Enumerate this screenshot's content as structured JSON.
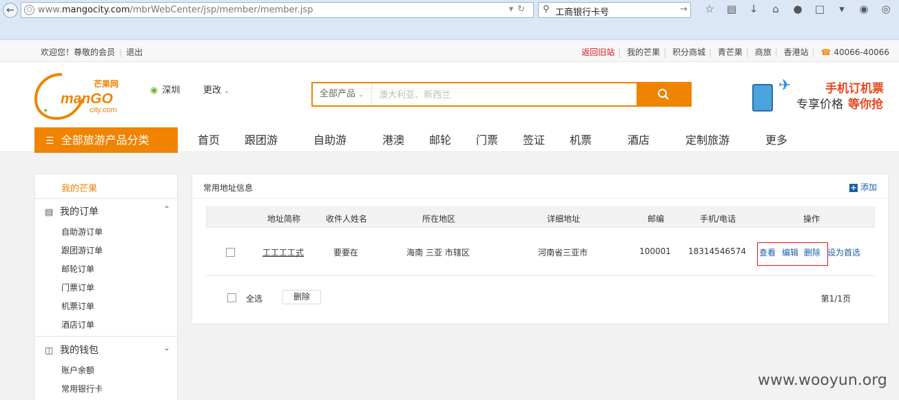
{
  "browser": {
    "url_prefix": "www.",
    "url_domain": "mangocity.com",
    "url_path": "/mbrWebCenter/jsp/member/member.jsp",
    "search_query": "工商银行卡号"
  },
  "topbar": {
    "welcome": "欢迎您！尊敬的会员",
    "logout": "退出",
    "back_old": "返回旧站",
    "my_mango": "我的芒果",
    "points_mall": "积分商城",
    "qing_mango": "青芒果",
    "business": "商旅",
    "hk_site": "香港站",
    "phone": "40066-40066"
  },
  "header": {
    "logo_cn": "芒果网",
    "logo_en1": "manGO",
    "logo_en2": "city.com",
    "city": "深圳",
    "change": "更改",
    "search_category": "全部产品",
    "search_placeholder": "澳大利亚、新西兰",
    "promo_line1": "手机订机票",
    "promo_line2": "专享价格",
    "promo_line3": "等你抢",
    "category_button": "全部旅游产品分类",
    "nav": [
      "首页",
      "跟团游",
      "自助游",
      "港澳",
      "邮轮",
      "门票",
      "签证",
      "机票",
      "酒店",
      "定制旅游",
      "更多"
    ]
  },
  "sidebar": {
    "my_mango": "我的芒果",
    "orders_title": "我的订单",
    "orders": [
      "自助游订单",
      "跟团游订单",
      "邮轮订单",
      "门票订单",
      "机票订单",
      "酒店订单"
    ],
    "wallet_title": "我的钱包",
    "wallet": [
      "账户余额",
      "常用银行卡"
    ]
  },
  "panel": {
    "title": "常用地址信息",
    "add": "添加",
    "columns": [
      "地址简称",
      "收件人姓名",
      "所在地区",
      "详细地址",
      "邮编",
      "手机/电话",
      "操作"
    ],
    "row": {
      "short_name": "工工工工式",
      "recipient": "要要在",
      "region": "海南 三亚 市辖区",
      "address": "河南省三亚市",
      "zip": "100001",
      "phone": "18314546574",
      "view": "查看",
      "edit": "编辑",
      "delete": "删除",
      "set_default": "设为首选"
    },
    "select_all": "全选",
    "delete_button": "删除",
    "pagination": "第1/1页"
  },
  "watermark": "www.wooyun.org",
  "colors": {
    "brand_orange": "#f08300",
    "link_blue": "#1a5fa8",
    "alert_red": "#d9141b"
  }
}
